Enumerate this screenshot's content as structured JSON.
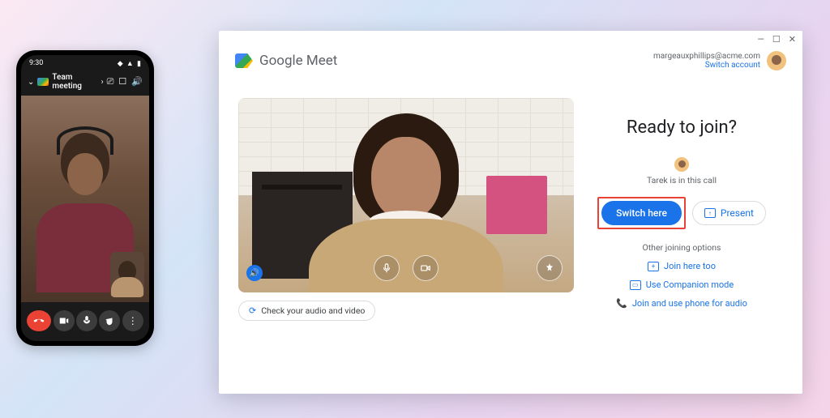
{
  "phone": {
    "status_time": "9:30",
    "meeting_title": "Team meeting",
    "controls": {
      "end": "end-call",
      "camera": "camera",
      "mic": "microphone",
      "raise_hand": "raise-hand",
      "more": "more"
    }
  },
  "window": {
    "brand": "Google Meet",
    "account_email": "margeauxphillips@acme.com",
    "switch_account": "Switch account",
    "check_av": "Check your audio and video",
    "ready_heading": "Ready to join?",
    "in_call_text": "Tarek is in this call",
    "switch_here": "Switch here",
    "present": "Present",
    "other_options_label": "Other joining options",
    "options": {
      "join_here_too": "Join here too",
      "companion": "Use Companion mode",
      "phone_audio": "Join and use phone for audio"
    }
  }
}
